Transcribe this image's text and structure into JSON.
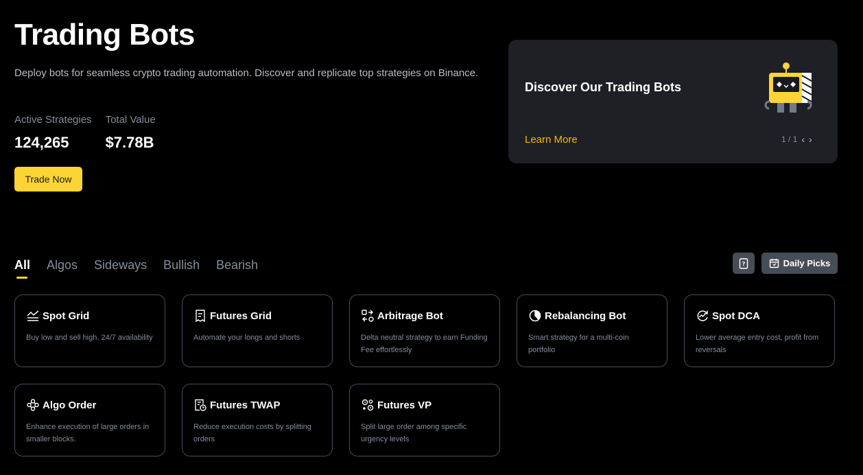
{
  "hero": {
    "title": "Trading Bots",
    "description": "Deploy bots for seamless crypto trading automation. Discover and replicate top strategies on Binance.",
    "stats": [
      {
        "label": "Active Strategies",
        "value": "124,265"
      },
      {
        "label": "Total Value",
        "value": "$7.78B"
      }
    ],
    "cta_label": "Trade Now"
  },
  "promo": {
    "title": "Discover Our Trading Bots",
    "link_label": "Learn More",
    "pager": "1 / 1",
    "illustration": "robot-icon"
  },
  "tabs": [
    {
      "label": "All",
      "active": true
    },
    {
      "label": "Algos",
      "active": false
    },
    {
      "label": "Sideways",
      "active": false
    },
    {
      "label": "Bullish",
      "active": false
    },
    {
      "label": "Bearish",
      "active": false
    }
  ],
  "toolbar": {
    "guide_icon": "book-icon",
    "daily_picks_label": "Daily Picks",
    "daily_picks_icon": "calendar-icon"
  },
  "bots": [
    {
      "name": "Spot Grid",
      "desc": "Buy low and sell high. 24/7 availability",
      "icon": "grid-chart-icon"
    },
    {
      "name": "Futures Grid",
      "desc": "Automate your longs and shorts",
      "icon": "futures-doc-icon"
    },
    {
      "name": "Arbitrage Bot",
      "desc": "Delta neutral strategy to earn Funding Fee effortlessly",
      "icon": "arbitrage-icon"
    },
    {
      "name": "Rebalancing Bot",
      "desc": "Smart strategy for a multi-coin portfolio",
      "icon": "pie-chart-icon"
    },
    {
      "name": "Spot DCA",
      "desc": "Lower average entry cost, profit from reversals",
      "icon": "dca-cycle-icon"
    },
    {
      "name": "Algo Order",
      "desc": "Enhance execution of large orders in smaller blocks.",
      "icon": "nodes-icon"
    },
    {
      "name": "Futures TWAP",
      "desc": "Reduce execution costs by splitting orders",
      "icon": "clock-doc-icon"
    },
    {
      "name": "Futures VP",
      "desc": "Split large order among specific urgency levels",
      "icon": "gears-icon"
    }
  ],
  "colors": {
    "accent": "#fcd535",
    "link": "#f0b90b",
    "card_border": "#474d57",
    "muted_text": "#848e9c"
  }
}
